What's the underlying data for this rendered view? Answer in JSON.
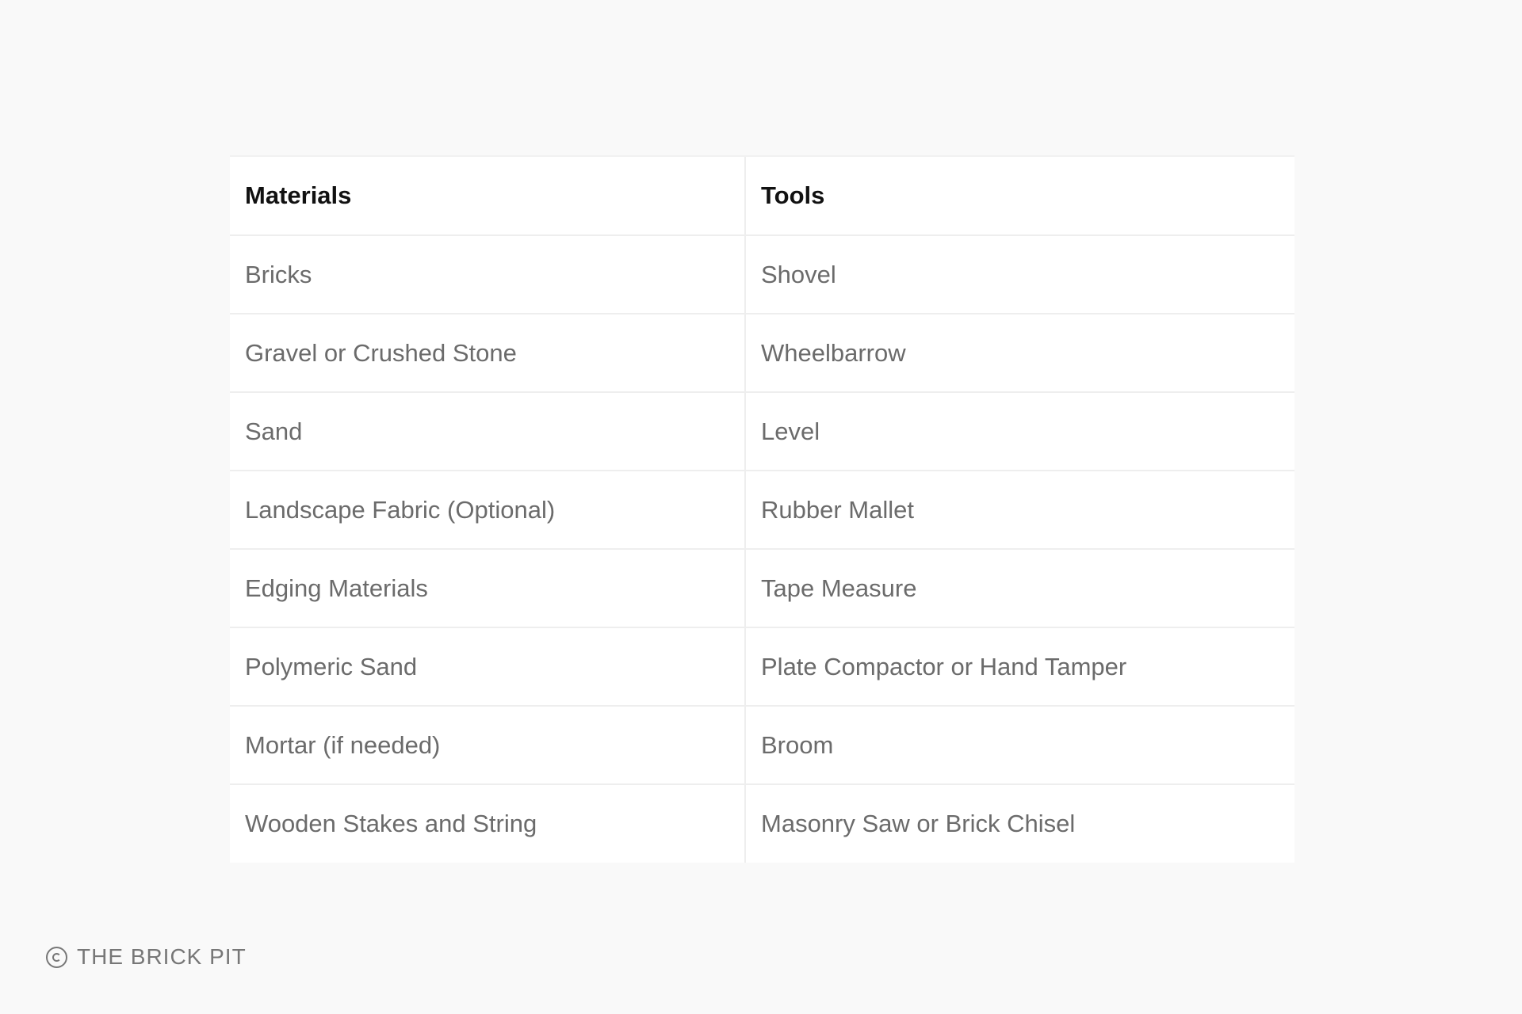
{
  "table": {
    "headers": [
      "Materials",
      "Tools"
    ],
    "rows": [
      [
        "Bricks",
        "Shovel"
      ],
      [
        "Gravel or Crushed Stone",
        "Wheelbarrow"
      ],
      [
        "Sand",
        "Level"
      ],
      [
        "Landscape Fabric (Optional)",
        "Rubber Mallet"
      ],
      [
        "Edging Materials",
        "Tape Measure"
      ],
      [
        "Polymeric Sand",
        "Plate Compactor or Hand Tamper"
      ],
      [
        "Mortar (if needed)",
        "Broom"
      ],
      [
        "Wooden Stakes and String",
        "Masonry Saw or Brick Chisel"
      ]
    ]
  },
  "watermark": {
    "text": "THE BRICK PIT",
    "icon": "copyright-icon"
  }
}
